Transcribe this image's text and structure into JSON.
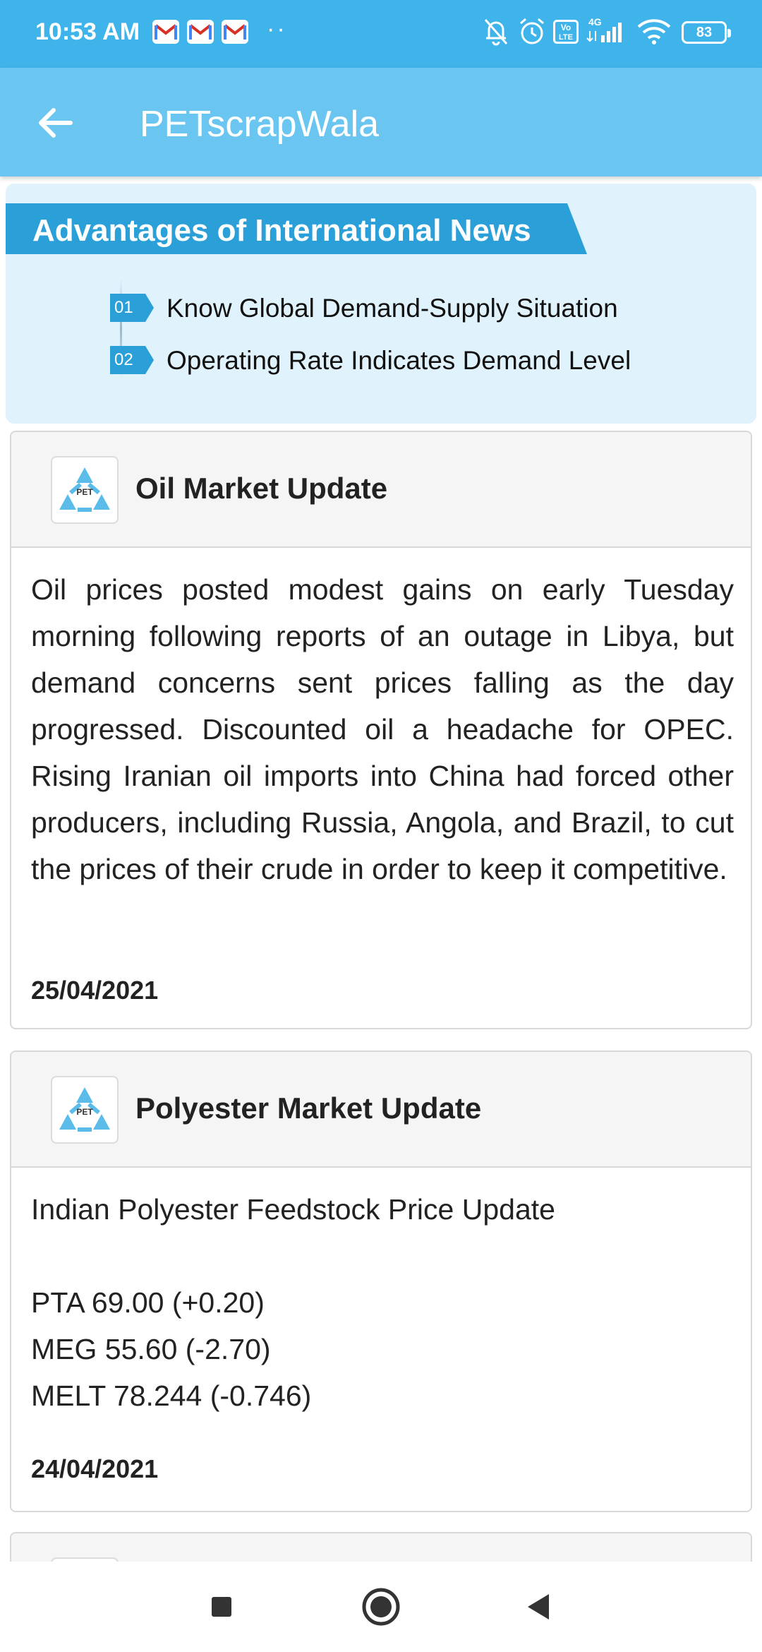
{
  "status_bar": {
    "time": "10:53 AM",
    "notifications": [
      "gmail-icon",
      "gmail-icon",
      "gmail-icon"
    ],
    "more": "··",
    "battery": "83",
    "network": "4G",
    "volte": "Vo LTE"
  },
  "app_bar": {
    "title": "PETscrapWala",
    "back_icon": "arrow-left-icon"
  },
  "banner": {
    "title": "Advantages of International News",
    "items": [
      {
        "num": "01",
        "text": "Know Global Demand-Supply Situation"
      },
      {
        "num": "02",
        "text": "Operating Rate Indicates Demand Level"
      }
    ]
  },
  "news": [
    {
      "title": "Oil Market Update",
      "body": "Oil prices posted modest gains on early Tuesday morning following reports of an outage in Libya, but demand concerns sent prices falling as the day progressed. Discounted oil a headache for OPEC. Rising Iranian oil imports into China had forced other producers, including Russia, Angola, and Brazil, to cut the prices of their crude in order to keep it competitive.",
      "date": "25/04/2021"
    },
    {
      "title": "Polyester Market Update",
      "body_lines": [
        "Indian Polyester Feedstock Price Update",
        "",
        "PTA 69.00 (+0.20)",
        "MEG 55.60 (-2.70)",
        "MELT 78.244 (-0.746)"
      ],
      "date": "24/04/2021"
    }
  ],
  "logo_text": "PET",
  "colors": {
    "status_bar": "#3fb4ea",
    "app_bar": "#6ac6f0",
    "banner_bg": "#e0f2fc",
    "banner_accent": "#2a9fd8"
  }
}
